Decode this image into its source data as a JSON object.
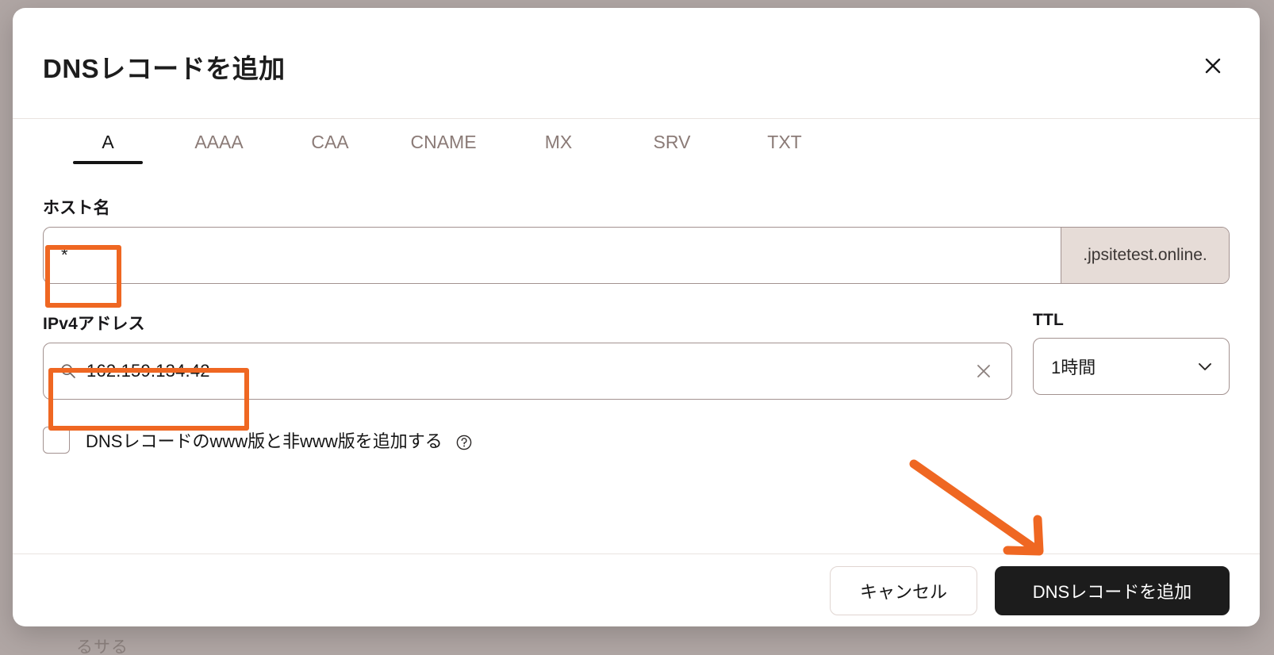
{
  "background": {
    "ghost_text": "るサる"
  },
  "modal": {
    "title": "DNSレコードを追加",
    "close_icon": "close-icon",
    "tabs": [
      {
        "label": "A",
        "active": true
      },
      {
        "label": "AAAA",
        "active": false
      },
      {
        "label": "CAA",
        "active": false
      },
      {
        "label": "CNAME",
        "active": false
      },
      {
        "label": "MX",
        "active": false
      },
      {
        "label": "SRV",
        "active": false
      },
      {
        "label": "TXT",
        "active": false
      }
    ],
    "hostname": {
      "label": "ホスト名",
      "value": "*",
      "placeholder": "",
      "suffix": ".jpsitetest.online."
    },
    "ipv4": {
      "label": "IPv4アドレス",
      "value": "162.159.134.42",
      "placeholder": "",
      "search_icon": "search-icon",
      "clear_icon": "clear-icon"
    },
    "ttl": {
      "label": "TTL",
      "value": "1時間",
      "chevron_icon": "chevron-down-icon",
      "options": [
        "1時間"
      ]
    },
    "www_checkbox": {
      "label": "DNSレコードのwww版と非www版を追加する",
      "checked": false,
      "help_icon": "help-circle-icon"
    },
    "footer": {
      "cancel_label": "キャンセル",
      "submit_label": "DNSレコードを追加"
    }
  },
  "annotations": {
    "color": "#ef6722",
    "highlight_hostname": "hostname-value-highlight",
    "highlight_ipv4": "ipv4-value-highlight",
    "arrow": "arrow-to-submit-button"
  }
}
